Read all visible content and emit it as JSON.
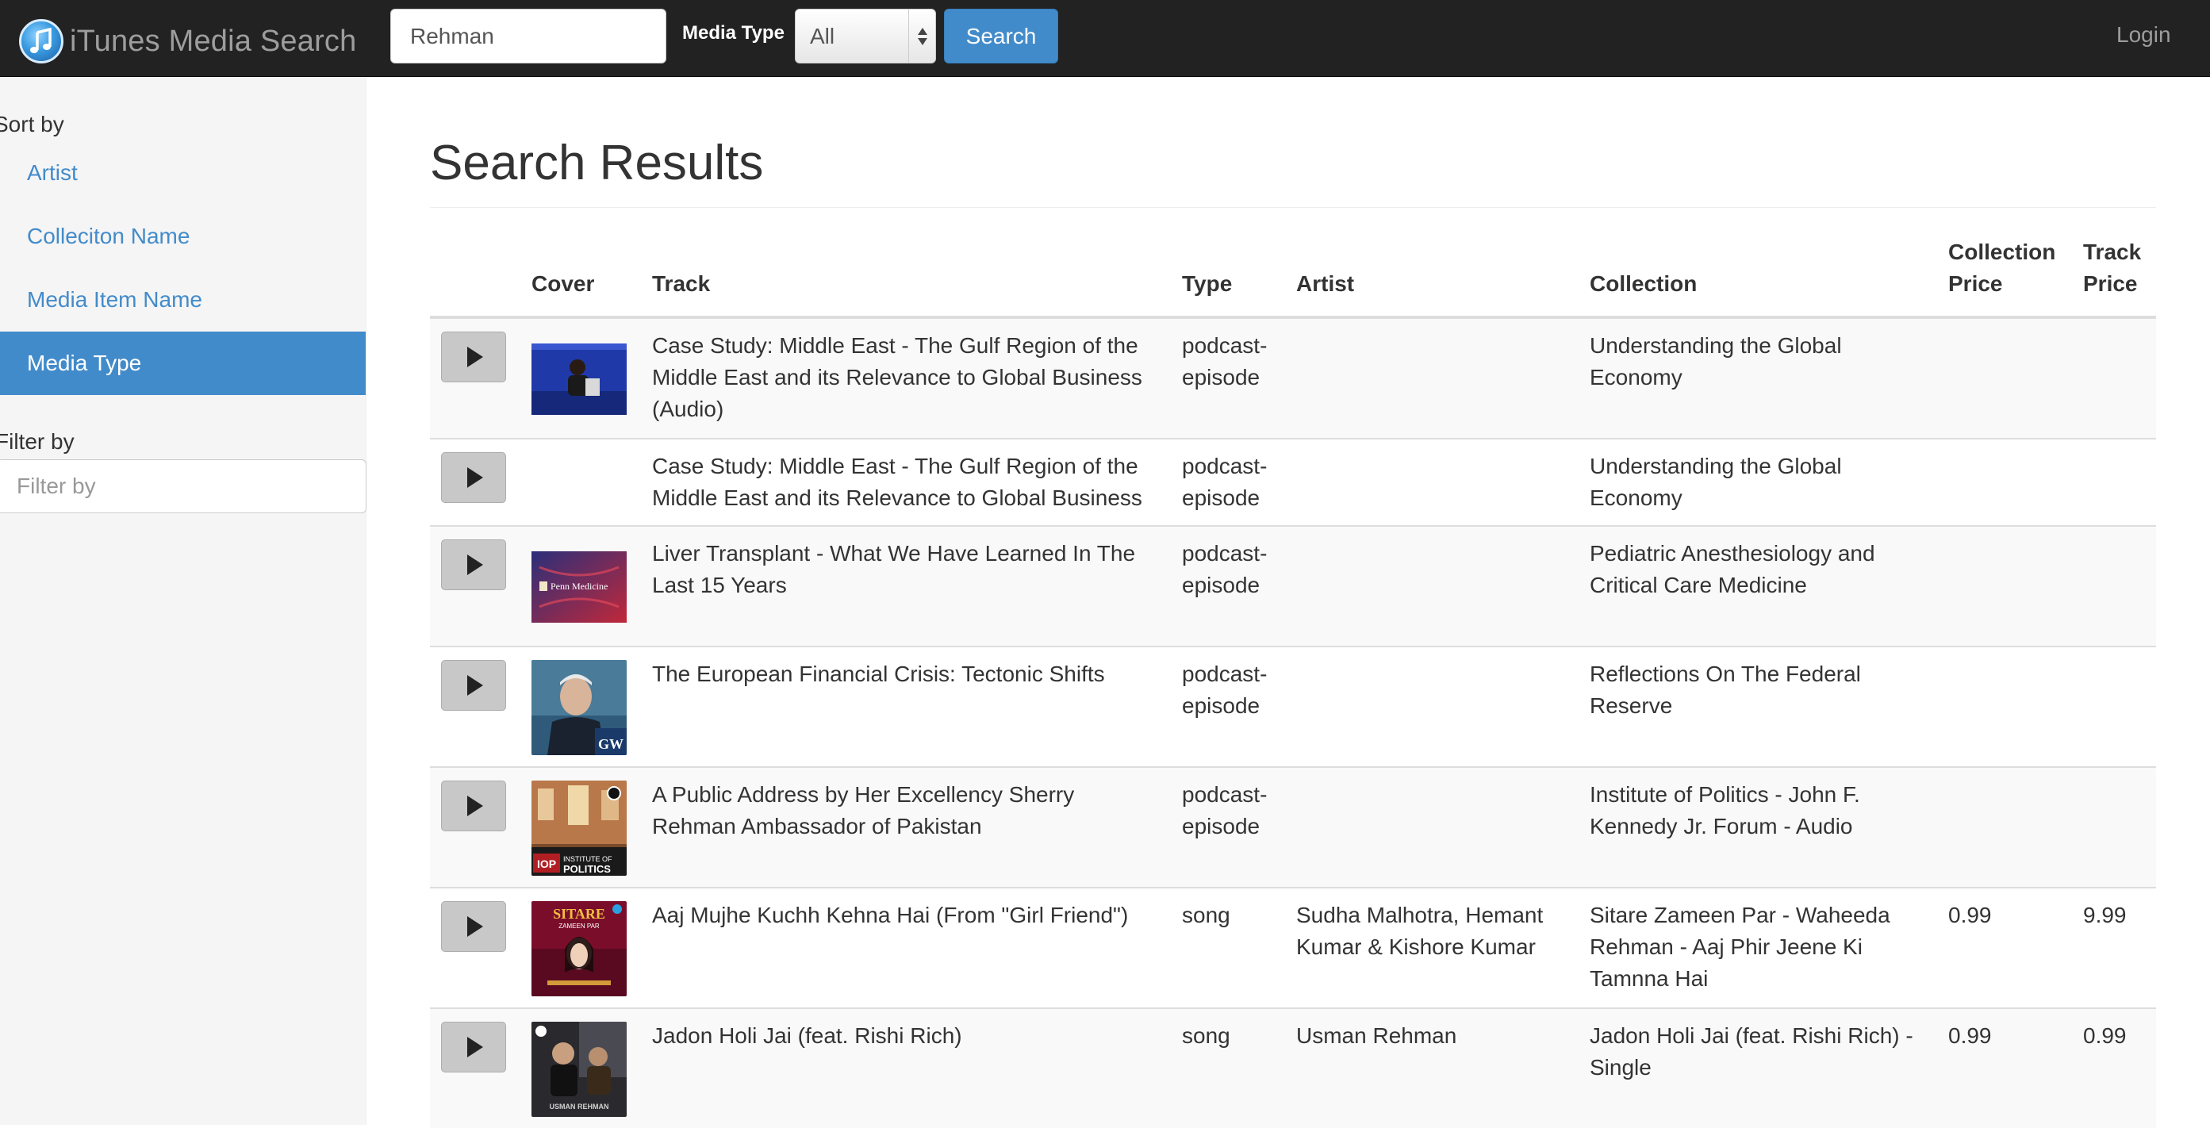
{
  "navbar": {
    "brand_title": "iTunes Media Search",
    "brand_icon": "music-note-icon",
    "search_value": "Rehman",
    "media_type_label": "Media Type",
    "media_type_value": "All",
    "search_button": "Search",
    "login": "Login"
  },
  "sidebar": {
    "sort_label": "Sort by",
    "sort_items": [
      {
        "label": "Artist",
        "active": false
      },
      {
        "label": "Colleciton Name",
        "active": false
      },
      {
        "label": "Media Item Name",
        "active": false
      },
      {
        "label": "Media Type",
        "active": true
      }
    ],
    "filter_label": "Filter by",
    "filter_placeholder": "Filter by"
  },
  "main": {
    "title": "Search Results",
    "columns": [
      "",
      "Cover",
      "Track",
      "Type",
      "Artist",
      "Collection",
      "Collection Price",
      "Track Price"
    ],
    "rows": [
      {
        "cover": "cover-speaker-podium",
        "track": "Case Study: Middle East - The Gulf Region of the Middle East and its Relevance to Global Business (Audio)",
        "type": "podcast-episode",
        "artist": "",
        "collection": "Understanding the Global Economy",
        "collection_price": "",
        "track_price": ""
      },
      {
        "cover": "",
        "track": "Case Study: Middle East - The Gulf Region of the Middle East and its Relevance to Global Business",
        "type": "podcast-episode",
        "artist": "",
        "collection": "Understanding the Global Economy",
        "collection_price": "",
        "track_price": ""
      },
      {
        "cover": "cover-penn-medicine",
        "track": "Liver Transplant - What We Have Learned In The Last 15 Years",
        "type": "podcast-episode",
        "artist": "",
        "collection": "Pediatric Anesthesiology and Critical Care Medicine",
        "collection_price": "",
        "track_price": ""
      },
      {
        "cover": "cover-gw-portrait",
        "track": "The European Financial Crisis: Tectonic Shifts",
        "type": "podcast-episode",
        "artist": "",
        "collection": "Reflections On The Federal Reserve",
        "collection_price": "",
        "track_price": ""
      },
      {
        "cover": "cover-iop",
        "track": "A Public Address by Her Excellency Sherry Rehman Ambassador of Pakistan",
        "type": "podcast-episode",
        "artist": "",
        "collection": "Institute of Politics - John F. Kennedy Jr. Forum - Audio",
        "collection_price": "",
        "track_price": ""
      },
      {
        "cover": "cover-sitare",
        "track": "Aaj Mujhe Kuchh Kehna Hai (From \"Girl Friend\")",
        "type": "song",
        "artist": "Sudha Malhotra, Hemant Kumar & Kishore Kumar",
        "collection": "Sitare Zameen Par - Waheeda Rehman - Aaj Phir Jeene Ki Tamnna Hai",
        "collection_price": "0.99",
        "track_price": "9.99"
      },
      {
        "cover": "cover-usman-rehman",
        "track": "Jadon Holi Jai (feat. Rishi Rich)",
        "type": "song",
        "artist": "Usman Rehman",
        "collection": "Jadon Holi Jai (feat. Rishi Rich) - Single",
        "collection_price": "0.99",
        "track_price": "0.99"
      }
    ],
    "cover_logos": {
      "penn": "Penn Medicine",
      "gw": "GW",
      "iop_badge": "IOP",
      "iop_text_1": "INSTITUTE OF",
      "iop_text_2": "POLITICS",
      "sitare": "SITARE",
      "sitare_sub": "ZAMEEN PAR",
      "usman": "USMAN REHMAN"
    }
  },
  "colors": {
    "navbar_bg": "#222222",
    "primary": "#428bca",
    "sidebar_bg": "#f5f5f5",
    "stripe": "#f9f9f9"
  }
}
